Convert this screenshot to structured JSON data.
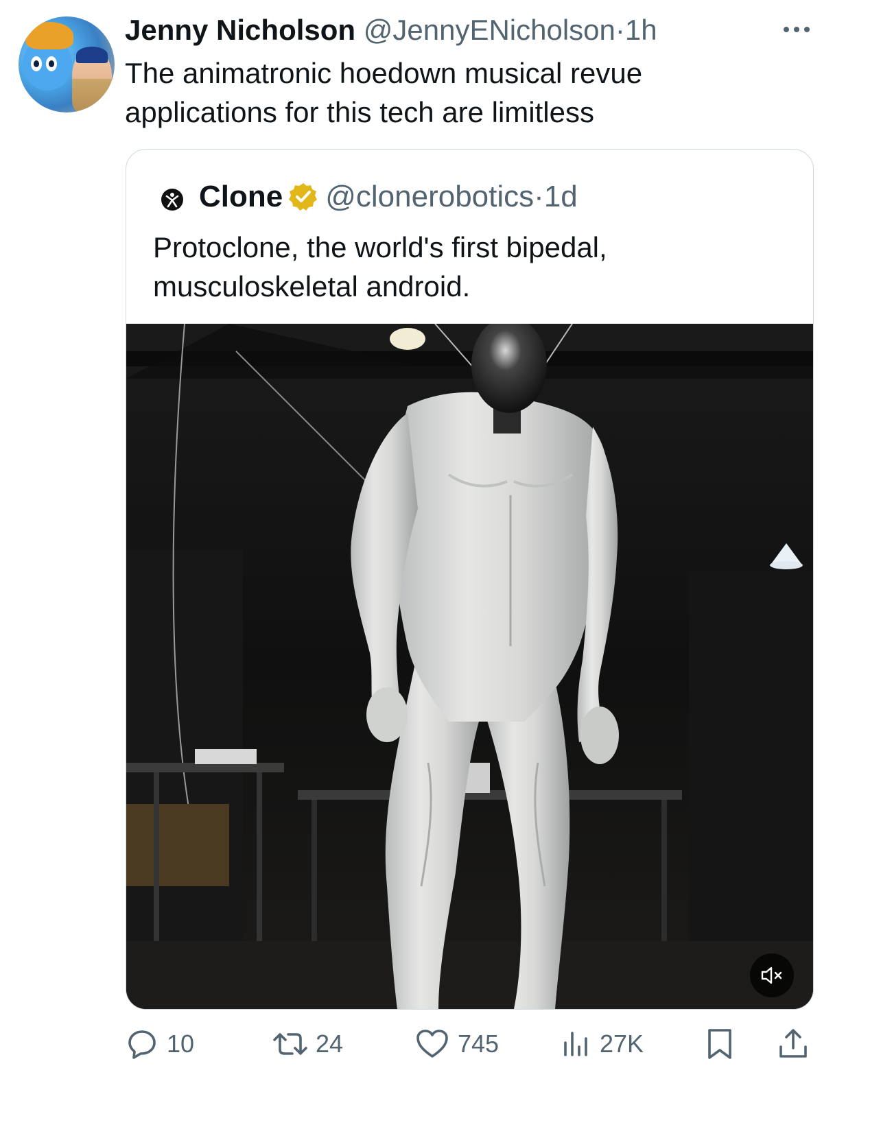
{
  "post": {
    "author_name": "Jenny Nicholson",
    "author_handle": "@JennyENicholson",
    "separator": "·",
    "time": "1h",
    "text": "The animatronic hoedown musical revue applications for this tech are limitless"
  },
  "quoted_post": {
    "author_name": "Clone",
    "author_handle": "@clonerobotics",
    "separator": "·",
    "time": "1d",
    "verified": true,
    "text": "Protoclone, the world's first bipedal, musculoskeletal android."
  },
  "media": {
    "muted": true
  },
  "actions": {
    "replies": "10",
    "reposts": "24",
    "likes": "745",
    "views": "27K"
  },
  "icons": {
    "more": "more-horizontal-icon",
    "reply": "reply-icon",
    "repost": "repost-icon",
    "like": "heart-icon",
    "views": "views-chart-icon",
    "bookmark": "bookmark-icon",
    "share": "share-icon",
    "verified": "verified-badge-icon",
    "mute": "volume-muted-icon"
  },
  "colors": {
    "text_primary": "#0f1419",
    "text_secondary": "#536471",
    "verified_badge": "#e2b719",
    "border": "#cfd9de"
  }
}
